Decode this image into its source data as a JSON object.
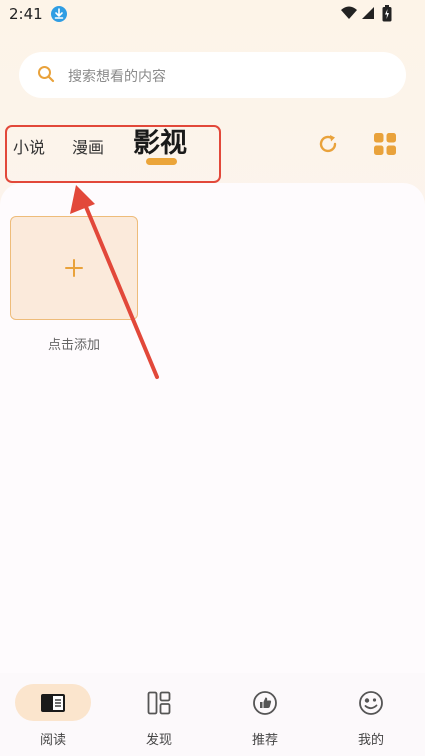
{
  "status_bar": {
    "time": "2:41"
  },
  "search": {
    "placeholder": "搜索想看的内容"
  },
  "tabs": [
    {
      "label": "小说"
    },
    {
      "label": "漫画"
    },
    {
      "label": "影视"
    }
  ],
  "content": {
    "add_label": "点击添加"
  },
  "bottom_nav": [
    {
      "label": "阅读"
    },
    {
      "label": "发现"
    },
    {
      "label": "推荐"
    },
    {
      "label": "我的"
    }
  ],
  "colors": {
    "accent": "#eba53a",
    "annotation": "#e2483a",
    "download": "#2f9de3"
  }
}
